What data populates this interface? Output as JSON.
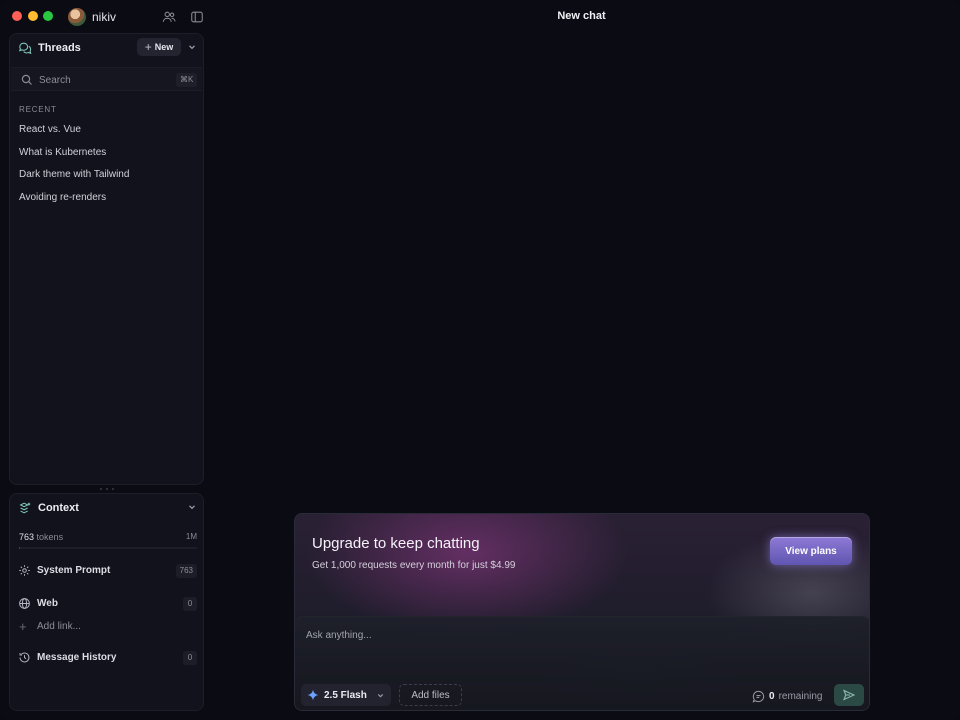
{
  "titlebar": {
    "username": "nikiv",
    "window_title": "New chat",
    "icons": [
      "people-icon",
      "sidebar-toggle-icon"
    ]
  },
  "threads": {
    "title": "Threads",
    "new_label": "New",
    "search": {
      "placeholder": "Search",
      "shortcut": "⌘K"
    },
    "recent_label": "RECENT",
    "items": [
      {
        "label": "React vs. Vue"
      },
      {
        "label": "What is Kubernetes"
      },
      {
        "label": "Dark theme with Tailwind"
      },
      {
        "label": "Avoiding re-renders"
      }
    ]
  },
  "context": {
    "title": "Context",
    "tokens_count": "763",
    "tokens_label": "tokens",
    "tokens_max": "1M",
    "tokens_fraction": 0.000763,
    "rows": {
      "system_prompt": {
        "label": "System Prompt",
        "count": "763"
      },
      "web": {
        "label": "Web",
        "count": "0"
      },
      "add_link": {
        "label": "Add link..."
      },
      "message_history": {
        "label": "Message History",
        "count": "0"
      }
    }
  },
  "upgrade": {
    "title": "Upgrade to keep chatting",
    "subtitle": "Get 1,000 requests every month for just $4.99",
    "button": "View plans"
  },
  "composer": {
    "placeholder": "Ask anything...",
    "model": "2.5 Flash",
    "add_files": "Add files",
    "remaining_count": "0",
    "remaining_label": "remaining"
  },
  "colors": {
    "accent_teal": "#7fc6b8",
    "upgrade_button": "#7a6ad0",
    "send_button": "#2c4a45",
    "sparkle_blue": "#6ea1ff"
  }
}
